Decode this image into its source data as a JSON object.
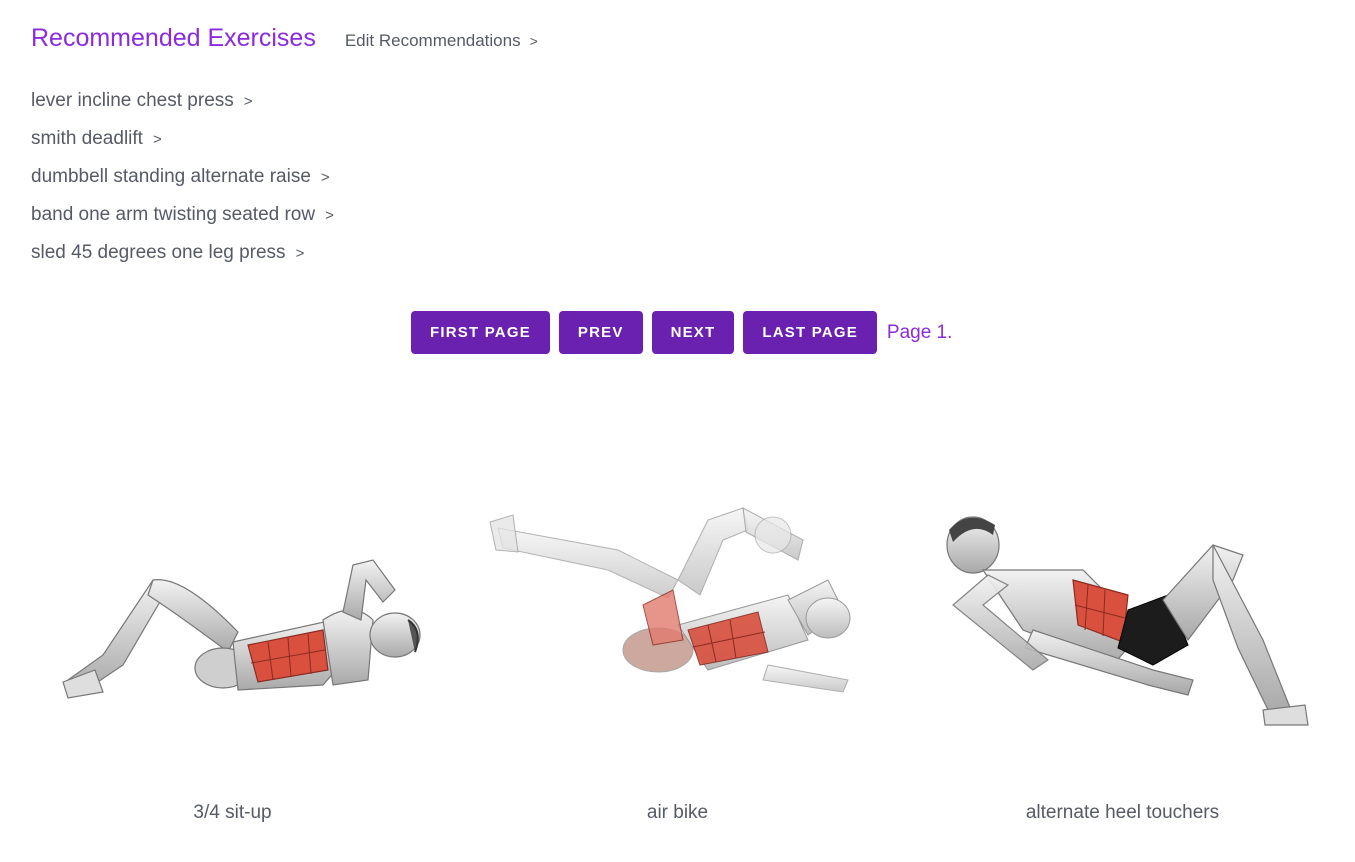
{
  "header": {
    "title": "Recommended Exercises",
    "edit_label": "Edit Recommendations",
    "chevron": ">"
  },
  "recommendations": [
    {
      "label": "lever incline chest press",
      "chevron": ">"
    },
    {
      "label": "smith deadlift",
      "chevron": ">"
    },
    {
      "label": "dumbbell standing alternate raise",
      "chevron": ">"
    },
    {
      "label": "band one arm twisting seated row",
      "chevron": ">"
    },
    {
      "label": "sled 45 degrees one leg press",
      "chevron": ">"
    }
  ],
  "pagination": {
    "first_label": "FIRST PAGE",
    "prev_label": "PREV",
    "next_label": "NEXT",
    "last_label": "LAST PAGE",
    "page_indicator": "Page 1."
  },
  "exercises": [
    {
      "name": "3/4 sit-up",
      "image": "sit-up-illustration"
    },
    {
      "name": "air bike",
      "image": "air-bike-illustration"
    },
    {
      "name": "alternate heel touchers",
      "image": "heel-touchers-illustration"
    }
  ],
  "colors": {
    "accent": "#8a2be2",
    "button_bg": "#6a21b0",
    "text": "#555a66",
    "muscle_highlight": "#d9503f"
  }
}
